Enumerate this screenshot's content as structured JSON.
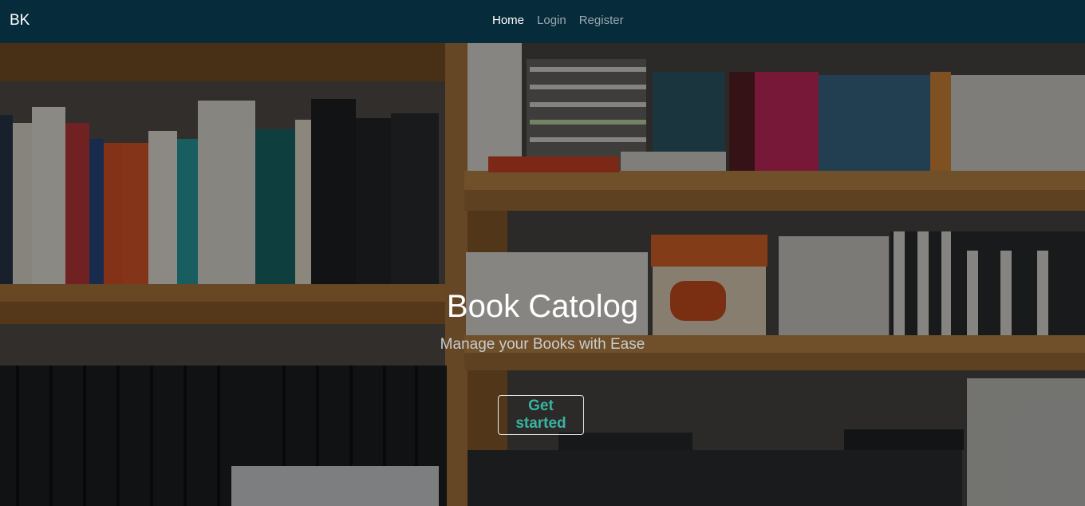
{
  "navbar": {
    "brand": "BK",
    "links": [
      "Home",
      "Login",
      "Register"
    ],
    "active": "Home"
  },
  "hero": {
    "title": "Book Catolog",
    "subtitle": "Manage your Books with Ease",
    "cta_label": "Get started"
  },
  "colors": {
    "navbar_bg": "#062b3a",
    "cta_text": "#39b3a2",
    "brand_text": "#ffffff"
  }
}
